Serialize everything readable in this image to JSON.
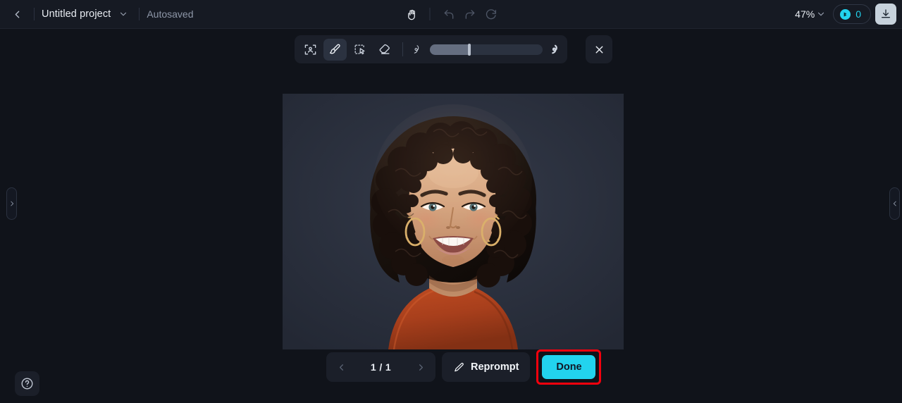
{
  "header": {
    "back_icon": "chevron-left-icon",
    "project_title": "Untitled project",
    "project_dropdown_icon": "chevron-down-icon",
    "save_status": "Autosaved",
    "pan_tool_icon": "hand-icon",
    "undo_icon": "undo-arrow-icon",
    "redo_icon": "redo-arrow-icon",
    "reset_icon": "refresh-icon",
    "zoom_level": "47%",
    "zoom_dropdown_icon": "chevron-down-icon",
    "credits_icon": "credit-coin-icon",
    "credits_count": "0",
    "download_icon": "download-icon"
  },
  "toolbar": {
    "tools": [
      {
        "name": "select-subject-tool",
        "icon": "person-in-frame-icon",
        "active": false
      },
      {
        "name": "brush-tool",
        "icon": "paintbrush-icon",
        "active": true
      },
      {
        "name": "magic-select-tool",
        "icon": "lasso-cursor-icon",
        "active": false
      },
      {
        "name": "eraser-tool",
        "icon": "eraser-icon",
        "active": false
      }
    ],
    "brush_size": {
      "min_icon": "small-stroke-icon",
      "max_icon": "large-stroke-icon",
      "value": 35
    },
    "close_icon": "close-x-icon"
  },
  "canvas": {
    "image_alt": "Portrait of a smiling woman with short curly dark hair, gold hoop earrings, wearing a rust-colored off-shoulder top",
    "colors": {
      "background": "#2a2f3c",
      "hair": "#1c1512",
      "skin": "#d2a483",
      "garment": "#b34422"
    }
  },
  "panels": {
    "left_handle_icon": "chevron-right-icon",
    "right_handle_icon": "chevron-left-icon"
  },
  "bottom_bar": {
    "prev_icon": "chevron-left-icon",
    "page_label": "1 / 1",
    "next_icon": "chevron-right-icon",
    "reprompt_icon": "pencil-icon",
    "reprompt_label": "Reprompt",
    "done_label": "Done",
    "done_highlight_color": "#f5000d",
    "done_button_color": "#22d3ee"
  },
  "help": {
    "icon": "question-mark-circle-icon"
  }
}
